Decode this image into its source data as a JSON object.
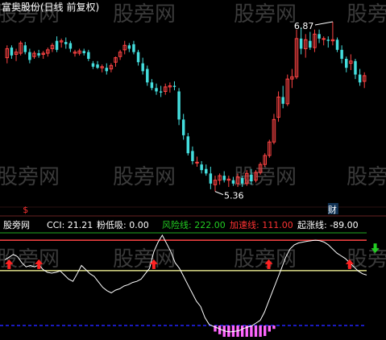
{
  "header": {
    "title": "富奥股份(日线 前复权)",
    "colors": {
      "title": "#ffffff",
      "background": "#000000"
    }
  },
  "price_panel": {
    "high_marker": "6.87",
    "low_marker": "5.36",
    "event_marker_left": "$",
    "event_marker_right": "财"
  },
  "indicator_header": {
    "name": "股旁网",
    "cci_label": "CCI: 21.21",
    "fen_label": "粉低吸: 0.00",
    "risk_label": "风险线: 222.00",
    "accel_label": "加速线: 111.00",
    "start_label": "起涨线: -89.00",
    "colors": {
      "name": "#ffffff",
      "cci": "#ffffff",
      "fen": "#ffffff",
      "risk": "#22cc22",
      "accel": "#ff3333",
      "start": "#ffffff"
    }
  },
  "watermark": "股旁网",
  "chart_data": [
    {
      "type": "candlestick",
      "title": "富奥股份(日线 前复权)",
      "up_color": "#ff4444",
      "down_color": "#44dddd",
      "high": 6.87,
      "low": 5.36,
      "candles": [
        {
          "o": 6.55,
          "h": 6.66,
          "l": 6.5,
          "c": 6.63
        },
        {
          "o": 6.64,
          "h": 6.66,
          "l": 6.54,
          "c": 6.57
        },
        {
          "o": 6.58,
          "h": 6.63,
          "l": 6.52,
          "c": 6.6
        },
        {
          "o": 6.59,
          "h": 6.7,
          "l": 6.57,
          "c": 6.68
        },
        {
          "o": 6.66,
          "h": 6.69,
          "l": 6.58,
          "c": 6.6
        },
        {
          "o": 6.6,
          "h": 6.63,
          "l": 6.5,
          "c": 6.53
        },
        {
          "o": 6.56,
          "h": 6.61,
          "l": 6.54,
          "c": 6.59
        },
        {
          "o": 6.59,
          "h": 6.62,
          "l": 6.55,
          "c": 6.57
        },
        {
          "o": 6.58,
          "h": 6.61,
          "l": 6.54,
          "c": 6.59
        },
        {
          "o": 6.59,
          "h": 6.64,
          "l": 6.56,
          "c": 6.62
        },
        {
          "o": 6.63,
          "h": 6.68,
          "l": 6.6,
          "c": 6.66
        },
        {
          "o": 6.7,
          "h": 6.74,
          "l": 6.6,
          "c": 6.62
        },
        {
          "o": 6.69,
          "h": 6.72,
          "l": 6.64,
          "c": 6.7
        },
        {
          "o": 6.69,
          "h": 6.73,
          "l": 6.63,
          "c": 6.67
        },
        {
          "o": 6.68,
          "h": 6.7,
          "l": 6.6,
          "c": 6.63
        },
        {
          "o": 6.59,
          "h": 6.62,
          "l": 6.56,
          "c": 6.6
        },
        {
          "o": 6.59,
          "h": 6.63,
          "l": 6.57,
          "c": 6.61
        },
        {
          "o": 6.61,
          "h": 6.63,
          "l": 6.57,
          "c": 6.59
        },
        {
          "o": 6.6,
          "h": 6.62,
          "l": 6.52,
          "c": 6.54
        },
        {
          "o": 6.5,
          "h": 6.52,
          "l": 6.45,
          "c": 6.47
        },
        {
          "o": 6.49,
          "h": 6.52,
          "l": 6.45,
          "c": 6.46
        },
        {
          "o": 6.46,
          "h": 6.49,
          "l": 6.42,
          "c": 6.47
        },
        {
          "o": 6.46,
          "h": 6.5,
          "l": 6.4,
          "c": 6.43
        },
        {
          "o": 6.45,
          "h": 6.5,
          "l": 6.42,
          "c": 6.48
        },
        {
          "o": 6.51,
          "h": 6.56,
          "l": 6.47,
          "c": 6.55
        },
        {
          "o": 6.56,
          "h": 6.62,
          "l": 6.53,
          "c": 6.6
        },
        {
          "o": 6.62,
          "h": 6.7,
          "l": 6.58,
          "c": 6.66
        },
        {
          "o": 6.66,
          "h": 6.68,
          "l": 6.6,
          "c": 6.63
        },
        {
          "o": 6.67,
          "h": 6.7,
          "l": 6.58,
          "c": 6.6
        },
        {
          "o": 6.6,
          "h": 6.62,
          "l": 6.48,
          "c": 6.51
        },
        {
          "o": 6.5,
          "h": 6.55,
          "l": 6.4,
          "c": 6.43
        },
        {
          "o": 6.45,
          "h": 6.48,
          "l": 6.3,
          "c": 6.33
        },
        {
          "o": 6.33,
          "h": 6.36,
          "l": 6.26,
          "c": 6.28
        },
        {
          "o": 6.28,
          "h": 6.32,
          "l": 6.22,
          "c": 6.25
        },
        {
          "o": 6.25,
          "h": 6.3,
          "l": 6.2,
          "c": 6.24
        },
        {
          "o": 6.25,
          "h": 6.32,
          "l": 6.22,
          "c": 6.29
        },
        {
          "o": 6.29,
          "h": 6.33,
          "l": 6.24,
          "c": 6.3
        },
        {
          "o": 6.3,
          "h": 6.34,
          "l": 6.26,
          "c": 6.29
        },
        {
          "o": 6.25,
          "h": 6.28,
          "l": 5.95,
          "c": 6.0
        },
        {
          "o": 6.0,
          "h": 6.05,
          "l": 5.82,
          "c": 5.86
        },
        {
          "o": 5.85,
          "h": 5.88,
          "l": 5.68,
          "c": 5.7
        },
        {
          "o": 5.72,
          "h": 5.76,
          "l": 5.6,
          "c": 5.63
        },
        {
          "o": 5.62,
          "h": 5.67,
          "l": 5.58,
          "c": 5.62
        },
        {
          "o": 5.6,
          "h": 5.63,
          "l": 5.52,
          "c": 5.55
        },
        {
          "o": 5.56,
          "h": 5.6,
          "l": 5.5,
          "c": 5.52
        },
        {
          "o": 5.52,
          "h": 5.58,
          "l": 5.38,
          "c": 5.43
        },
        {
          "o": 5.42,
          "h": 5.5,
          "l": 5.36,
          "c": 5.46
        },
        {
          "o": 5.46,
          "h": 5.52,
          "l": 5.42,
          "c": 5.5
        },
        {
          "o": 5.5,
          "h": 5.54,
          "l": 5.44,
          "c": 5.46
        },
        {
          "o": 5.46,
          "h": 5.5,
          "l": 5.4,
          "c": 5.47
        },
        {
          "o": 5.46,
          "h": 5.49,
          "l": 5.41,
          "c": 5.43
        },
        {
          "o": 5.43,
          "h": 5.52,
          "l": 5.4,
          "c": 5.49
        },
        {
          "o": 5.48,
          "h": 5.5,
          "l": 5.4,
          "c": 5.43
        },
        {
          "o": 5.43,
          "h": 5.55,
          "l": 5.41,
          "c": 5.52
        },
        {
          "o": 5.51,
          "h": 5.56,
          "l": 5.42,
          "c": 5.45
        },
        {
          "o": 5.46,
          "h": 5.55,
          "l": 5.44,
          "c": 5.53
        },
        {
          "o": 5.53,
          "h": 5.62,
          "l": 5.51,
          "c": 5.6
        },
        {
          "o": 5.6,
          "h": 5.7,
          "l": 5.58,
          "c": 5.68
        },
        {
          "o": 5.68,
          "h": 5.82,
          "l": 5.66,
          "c": 5.8
        },
        {
          "o": 5.8,
          "h": 6.05,
          "l": 5.78,
          "c": 6.0
        },
        {
          "o": 6.02,
          "h": 6.25,
          "l": 5.98,
          "c": 6.2
        },
        {
          "o": 6.2,
          "h": 6.3,
          "l": 6.1,
          "c": 6.14
        },
        {
          "o": 6.14,
          "h": 6.4,
          "l": 6.12,
          "c": 6.36
        },
        {
          "o": 6.36,
          "h": 6.45,
          "l": 6.28,
          "c": 6.38
        },
        {
          "o": 6.38,
          "h": 6.8,
          "l": 6.36,
          "c": 6.72
        },
        {
          "o": 6.72,
          "h": 6.82,
          "l": 6.58,
          "c": 6.63
        },
        {
          "o": 6.63,
          "h": 6.76,
          "l": 6.55,
          "c": 6.71
        },
        {
          "o": 6.7,
          "h": 6.78,
          "l": 6.62,
          "c": 6.64
        },
        {
          "o": 6.64,
          "h": 6.8,
          "l": 6.6,
          "c": 6.76
        },
        {
          "o": 6.76,
          "h": 6.8,
          "l": 6.68,
          "c": 6.72
        },
        {
          "o": 6.72,
          "h": 6.74,
          "l": 6.66,
          "c": 6.72
        },
        {
          "o": 6.71,
          "h": 6.74,
          "l": 6.64,
          "c": 6.7
        },
        {
          "o": 6.7,
          "h": 6.87,
          "l": 6.66,
          "c": 6.71
        },
        {
          "o": 6.71,
          "h": 6.73,
          "l": 6.6,
          "c": 6.62
        },
        {
          "o": 6.62,
          "h": 6.66,
          "l": 6.5,
          "c": 6.54
        },
        {
          "o": 6.54,
          "h": 6.56,
          "l": 6.42,
          "c": 6.46
        },
        {
          "o": 6.5,
          "h": 6.58,
          "l": 6.44,
          "c": 6.52
        },
        {
          "o": 6.52,
          "h": 6.54,
          "l": 6.36,
          "c": 6.4
        },
        {
          "o": 6.4,
          "h": 6.45,
          "l": 6.3,
          "c": 6.33
        },
        {
          "o": 6.34,
          "h": 6.42,
          "l": 6.28,
          "c": 6.39
        }
      ]
    },
    {
      "type": "line",
      "title": "股旁网",
      "series_name": "CCI",
      "last_value": 21.21,
      "reference_lines": [
        {
          "name": "风险线",
          "value": 222.0,
          "color": "#ff4444"
        },
        {
          "name": "加速线",
          "value": 111.0,
          "color": "#dddd88"
        },
        {
          "name": "起涨线",
          "value": -89.0,
          "color": "#2222ff"
        }
      ],
      "ylim": [
        -130,
        240
      ],
      "values": [
        150,
        160,
        170,
        162,
        140,
        125,
        130,
        125,
        132,
        115,
        105,
        102,
        105,
        110,
        95,
        80,
        72,
        100,
        130,
        115,
        100,
        90,
        70,
        50,
        38,
        30,
        40,
        45,
        55,
        60,
        68,
        72,
        80,
        100,
        120,
        180,
        215,
        240,
        210,
        180,
        140,
        120,
        90,
        60,
        30,
        0,
        -20,
        -60,
        -85,
        -92,
        -98,
        -105,
        -110,
        -112,
        -110,
        -108,
        -100,
        -95,
        -90,
        -80,
        -70,
        -40,
        0,
        40,
        80,
        120,
        160,
        190,
        205,
        212,
        215,
        218,
        220,
        222,
        220,
        215,
        205,
        190,
        175,
        165,
        155,
        140,
        125,
        110,
        100,
        95
      ],
      "arrows_up_at": [
        1,
        8,
        35,
        62,
        81
      ],
      "arrows_down_at": [
        87
      ],
      "fen_low_absorb_bars": [
        46,
        47,
        48,
        49,
        50,
        51,
        52,
        53,
        54,
        55,
        56,
        57,
        58,
        59
      ],
      "fen_low_absorb_values": [
        -5,
        -8,
        -12,
        -15,
        -20,
        -25,
        -22,
        -20,
        -18,
        -15,
        -12,
        -10,
        -5,
        -2
      ]
    }
  ]
}
